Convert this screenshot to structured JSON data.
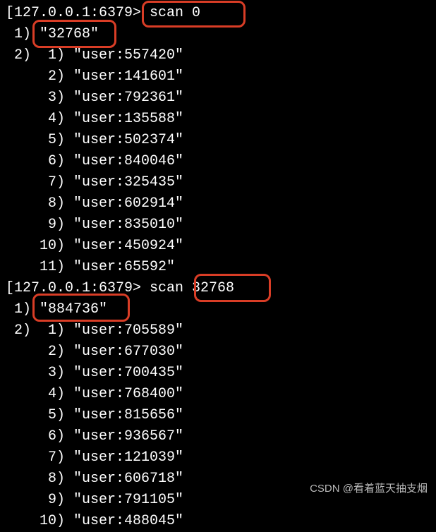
{
  "terminal": {
    "prompt": "127.0.0.1:6379>",
    "commands": [
      {
        "cmd": "scan 0",
        "cursor": "32768",
        "results": [
          "user:557420",
          "user:141601",
          "user:792361",
          "user:135588",
          "user:502374",
          "user:840046",
          "user:325435",
          "user:602914",
          "user:835010",
          "user:450924",
          "user:65592"
        ]
      },
      {
        "cmd": "scan 32768",
        "cursor": "884736",
        "results": [
          "user:705589",
          "user:677030",
          "user:700435",
          "user:768400",
          "user:815656",
          "user:936567",
          "user:121039",
          "user:606718",
          "user:791105",
          "user:488045"
        ]
      }
    ]
  },
  "watermark": "CSDN @看着蓝天抽支烟"
}
